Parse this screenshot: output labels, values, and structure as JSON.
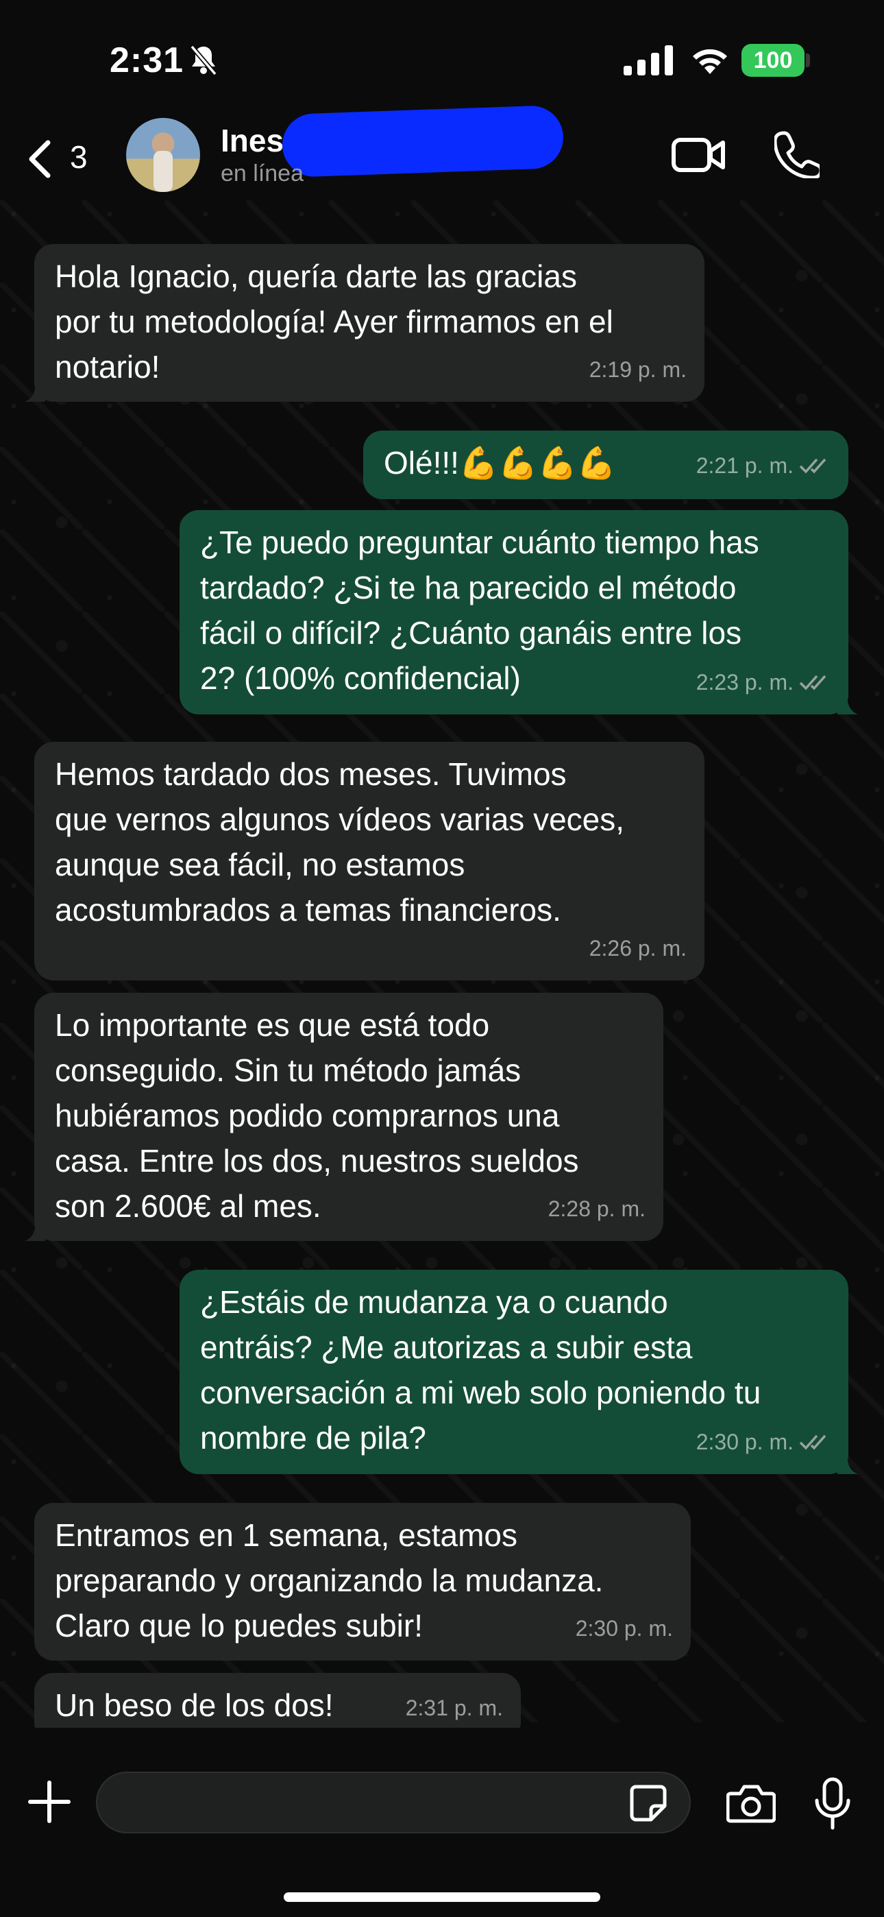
{
  "status_bar": {
    "time": "2:31",
    "battery": "100"
  },
  "header": {
    "back_count": "3",
    "contact_name": "Ines",
    "contact_status": "en línea"
  },
  "messages": [
    {
      "direction": "incoming",
      "text": "Hola Ignacio, quería darte las gracias\npor tu metodología! Ayer firmamos en el\nnotario!",
      "time": "2:19 p. m."
    },
    {
      "direction": "outgoing",
      "text": "Olé!!!💪💪💪💪",
      "time": "2:21 p. m."
    },
    {
      "direction": "outgoing",
      "text": "¿Te puedo preguntar cuánto tiempo has\ntardado? ¿Si te ha parecido el método\nfácil o difícil? ¿Cuánto ganáis entre los\n2? (100% confidencial)",
      "time": "2:23 p. m."
    },
    {
      "direction": "incoming",
      "text": "Hemos tardado dos meses. Tuvimos\nque vernos algunos vídeos varias veces,\naunque sea fácil, no estamos\nacostumbrados a temas financieros.",
      "time": "2:26 p. m."
    },
    {
      "direction": "incoming",
      "text": "Lo importante es que está todo\nconseguido. Sin tu método jamás\nhubiéramos podido comprarnos una\ncasa. Entre los dos, nuestros sueldos\nson 2.600€ al mes.",
      "time": "2:28 p. m."
    },
    {
      "direction": "outgoing",
      "text": "¿Estáis de mudanza ya o cuando\nentráis? ¿Me autorizas a subir esta\nconversación a mi web solo poniendo tu\nnombre de pila?",
      "time": "2:30 p. m."
    },
    {
      "direction": "incoming",
      "text": "Entramos en 1 semana, estamos\npreparando y organizando la mudanza.\nClaro que lo puedes subir!",
      "time": "2:30 p. m."
    },
    {
      "direction": "incoming",
      "text": "Un beso de los dos!",
      "time": "2:31 p. m."
    }
  ],
  "input": {
    "placeholder": ""
  },
  "colors": {
    "incoming": "#242626",
    "outgoing": "#144d37",
    "read_ticks": "#9aa3a0",
    "battery": "#34c759"
  },
  "icons": [
    "bell-slash-icon",
    "signal-icon",
    "wifi-icon",
    "back-chevron-icon",
    "video-call-icon",
    "phone-call-icon",
    "plus-icon",
    "sticker-icon",
    "camera-icon",
    "microphone-icon",
    "double-check-icon"
  ]
}
